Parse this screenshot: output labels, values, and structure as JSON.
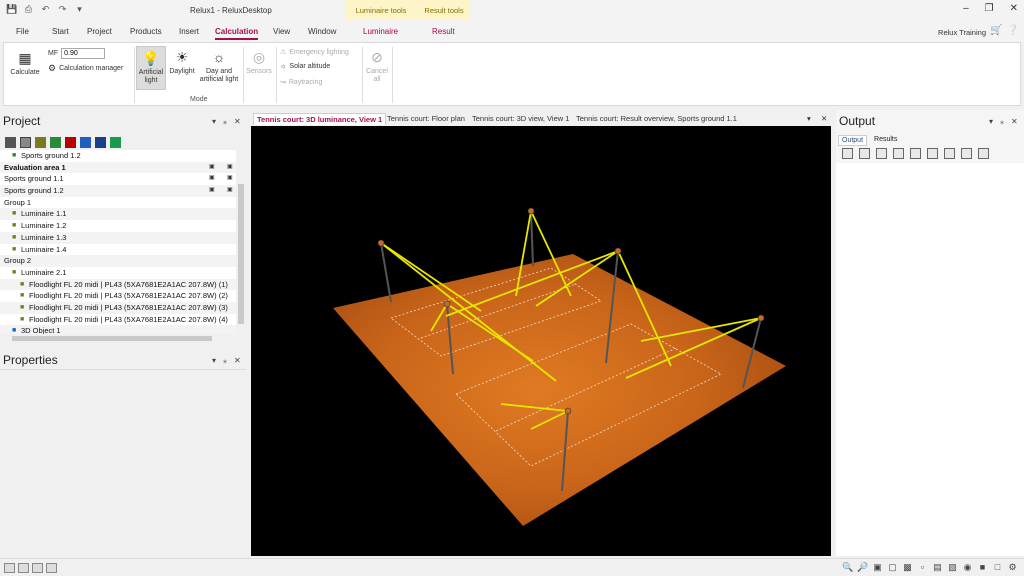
{
  "window": {
    "title": "Relux1 - ReluxDesktop",
    "context_tab_1": "Luminaire tools",
    "context_tab_2": "Result tools"
  },
  "menu": {
    "file": "File",
    "start": "Start",
    "project": "Project",
    "products": "Products",
    "insert": "Insert",
    "calculation": "Calculation",
    "view": "View",
    "window": "Window",
    "luminaire": "Luminaire",
    "result": "Result",
    "user": "Relux Training"
  },
  "ribbon": {
    "calculate": "Calculate",
    "mf_label": "MF",
    "mf_value": "0.90",
    "calc_manager": "Calculation manager",
    "artificial_light": "Artificial light",
    "daylight": "Daylight",
    "day_and_artificial": "Day and artificial light",
    "sensors": "Sensors",
    "emergency_lighting": "Emergency lighting",
    "solar_altitude": "Solar altitude",
    "raytracing": "Raytracing",
    "cancel_all": "Cancel all",
    "mode_group": "Mode"
  },
  "project_panel": {
    "title": "Project",
    "items": [
      {
        "label": "Sports ground 1.2",
        "indent": 1
      },
      {
        "label": "Evaluation area 1",
        "indent": 0,
        "bold": true
      },
      {
        "label": "Sports ground 1.1",
        "indent": 0
      },
      {
        "label": "Sports ground 1.2",
        "indent": 0
      },
      {
        "label": "Group  1",
        "indent": 0
      },
      {
        "label": "Luminaire  1.1",
        "indent": 1
      },
      {
        "label": "Luminaire  1.2",
        "indent": 1
      },
      {
        "label": "Luminaire  1.3",
        "indent": 1
      },
      {
        "label": "Luminaire  1.4",
        "indent": 1
      },
      {
        "label": "Group  2",
        "indent": 0
      },
      {
        "label": "Luminaire  2.1",
        "indent": 1
      },
      {
        "label": "Floodlight FL 20 midi | PL43 (5XA7681E2A1AC 207.8W) (1)",
        "indent": 2
      },
      {
        "label": "Floodlight FL 20 midi | PL43 (5XA7681E2A1AC 207.8W) (2)",
        "indent": 2
      },
      {
        "label": "Floodlight FL 20 midi | PL43 (5XA7681E2A1AC 207.8W) (3)",
        "indent": 2
      },
      {
        "label": "Floodlight FL 20 midi | PL43 (5XA7681E2A1AC 207.8W) (4)",
        "indent": 2
      },
      {
        "label": "3D Object  1",
        "indent": 1
      }
    ]
  },
  "properties_panel": {
    "title": "Properties"
  },
  "doc_tabs": [
    "Tennis court: 3D luminance, View 1",
    "Tennis court: Floor plan",
    "Tennis court: 3D view, View 1",
    "Tennis court: Result overview, Sports ground 1.1"
  ],
  "output_panel": {
    "title": "Output",
    "tab_output": "Output",
    "tab_results": "Results"
  },
  "colors": {
    "accent": "#a0114e",
    "ground": "#c9651a",
    "beam": "#e6e600"
  }
}
